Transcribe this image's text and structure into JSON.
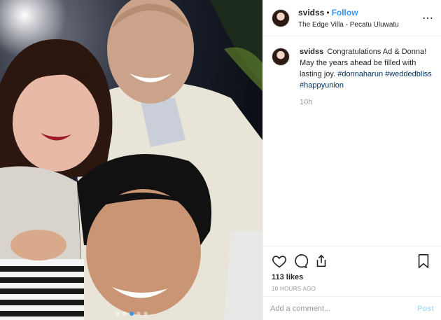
{
  "post": {
    "image_alt": "Selfie of three smiling people at an evening celebration",
    "carousel_dot_count": 5,
    "carousel_active_index": 2
  },
  "header": {
    "username": "svidss",
    "separator": "•",
    "follow_label": "Follow",
    "location": "The Edge Villa - Pecatu Uluwatu",
    "more_icon": "ellipsis-icon"
  },
  "caption": {
    "username": "svidss",
    "text": "Congratulations Ad & Donna! May the years ahead be filled with lasting joy.",
    "hashtags": [
      "#donnaharun",
      "#weddedbliss",
      "#happyunion"
    ],
    "time": "10h"
  },
  "actions": {
    "icons": [
      "heart-icon",
      "comment-icon",
      "share-icon",
      "bookmark-icon"
    ],
    "likes": "113 likes",
    "posted_ago": "10 HOURS AGO"
  },
  "comment_box": {
    "placeholder": "Add a comment...",
    "post_label": "Post"
  },
  "colors": {
    "link_blue": "#3897f0",
    "hashtag_blue": "#003569",
    "muted": "#999999",
    "border": "#efefef"
  }
}
